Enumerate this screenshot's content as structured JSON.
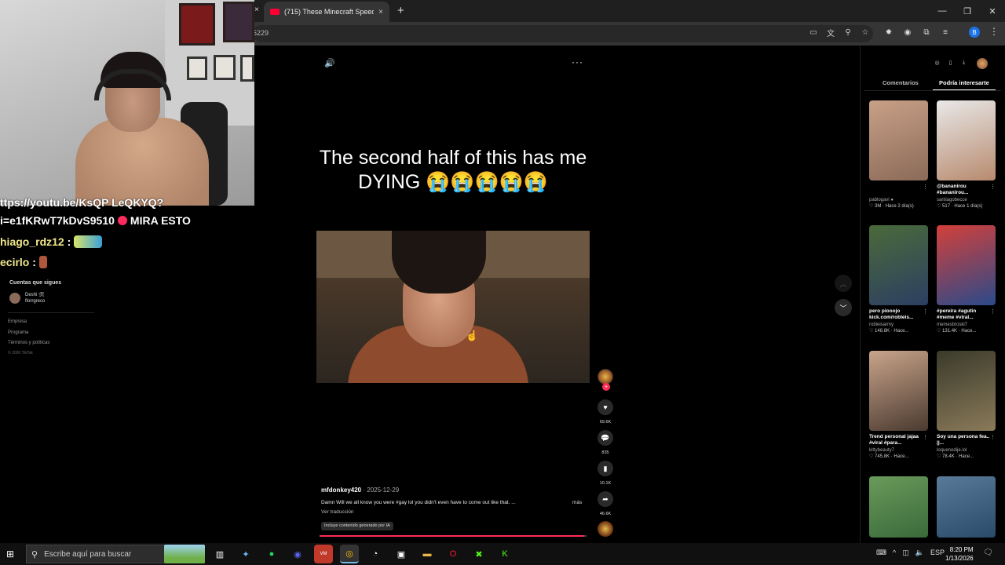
{
  "browser": {
    "tab_title": "(715) These Minecraft Speedrun",
    "tab_close": "×",
    "prev_tab_close": "×",
    "new_tab": "+",
    "url_fragment": "5229",
    "window_controls": [
      "—",
      "❐",
      "✕"
    ],
    "profile_letter": "B"
  },
  "chat": {
    "line1": "ttps://youtu.be/KsQP LeQKYQ?",
    "line2_prefix": "i=e1fKRwT7kDvS9510",
    "line2_suffix": "MIRA ESTO",
    "line3_user": "hiago_rdz12",
    "line3_sep": ":",
    "line4_user": "ecirlo",
    "line4_sep": ":"
  },
  "sidebar": {
    "following_title": "Cuentas que sigues",
    "following_name": "Deshi 🛠",
    "following_handle": "florrgreco",
    "links": [
      "Empresa",
      "Programa",
      "Términos y políticas"
    ],
    "copyright": "© 2026 TikTok"
  },
  "video": {
    "caption": "The second half of this has me DYING 😭😭😭😭😭",
    "author": "mfdonkey420",
    "date": " · 2025-12-29",
    "description": "Damn Will we all know you were #gay lol you didn't even have to come out like that. ...",
    "more": "más",
    "translate": "Ver traducción",
    "ai_label": "Incluye contenido generado por IA",
    "progress": 0.99
  },
  "actions": {
    "likes": "69.6K",
    "comments": "835",
    "saves": "10.1K",
    "shares": "46.6K"
  },
  "right_panel": {
    "tab_comments": "Comentarios",
    "tab_interest": "Podría interesarte",
    "cards": [
      {
        "title": "",
        "user": "pablogavi ●",
        "stats": "♡ 3M · Hace 2 día(s)",
        "colors": [
          "#c9a087",
          "#8a6a58"
        ]
      },
      {
        "title": "@bananirou #bananirou...",
        "user": "santiagobecce",
        "stats": "♡ 517 · Hace 1 día(s)",
        "colors": [
          "#e8e8e8",
          "#b88a6e"
        ]
      },
      {
        "title": "pero piooojo kick.com/robleis...",
        "user": "robleisarmy",
        "stats": "♡ 148.8K · Hace...",
        "colors": [
          "#4a6a3a",
          "#2c3f62"
        ]
      },
      {
        "title": "#pereira #agutin #meme #viral...",
        "user": "memesbroski7",
        "stats": "♡ 131.4K · Hace...",
        "colors": [
          "#d3403a",
          "#2a4a8a"
        ]
      },
      {
        "title": "Trend personal jajaa #viral #para...",
        "user": "kittybeauty7",
        "stats": "♡ 745.8K · Hace...",
        "colors": [
          "#c9a48a",
          "#4a3a30"
        ]
      },
      {
        "title": "Soy una persona fea.. ||...",
        "user": "loquenodije.lol",
        "stats": "♡ 78.4K · Hace...",
        "colors": [
          "#3a3a2a",
          "#8a7a5a"
        ]
      },
      {
        "title": "",
        "user": "",
        "stats": "",
        "colors": [
          "#6a9a5a",
          "#3a6a3a"
        ]
      },
      {
        "title": "",
        "user": "",
        "stats": "",
        "colors": [
          "#5a7a9a",
          "#2a4a6a"
        ]
      }
    ]
  },
  "taskbar": {
    "search_placeholder": "Escribe aquí para buscar",
    "lang": "ESP",
    "time": "8:20 PM",
    "date": "1/13/2026"
  }
}
